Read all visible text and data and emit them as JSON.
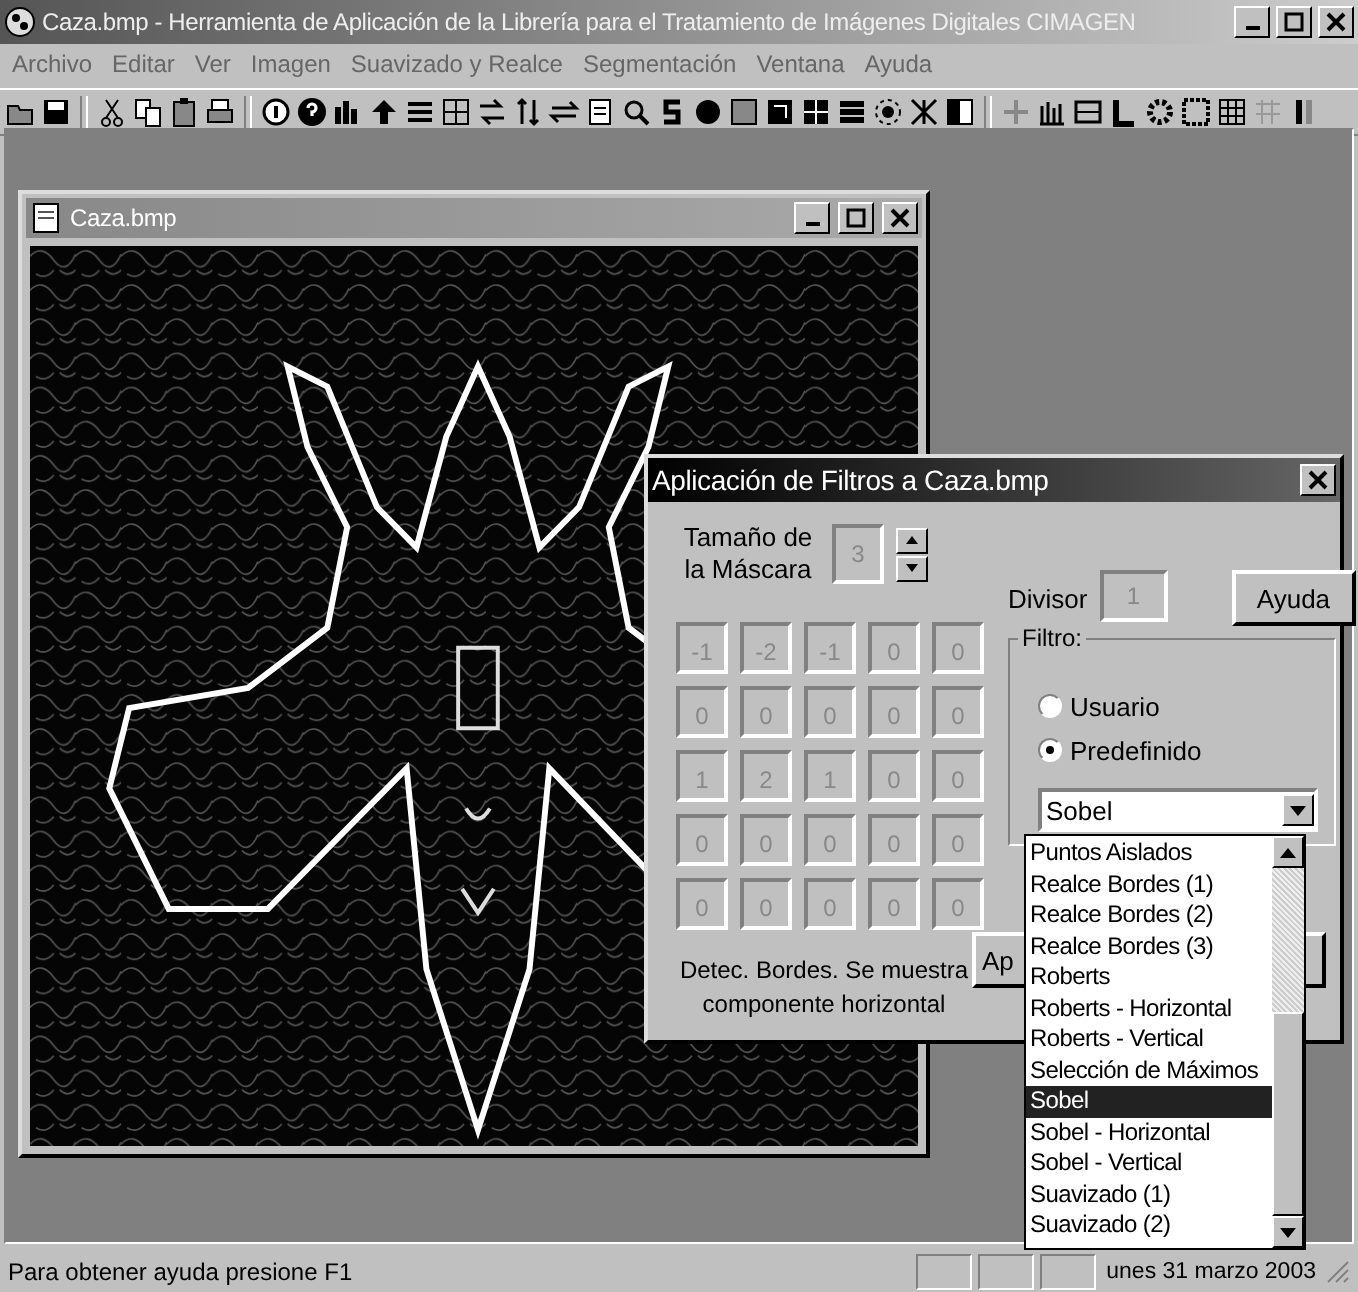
{
  "window": {
    "title": "Caza.bmp - Herramienta de Aplicación de la Librería para el Tratamiento de Imágenes Digitales CIMAGEN"
  },
  "menu": [
    "Archivo",
    "Editar",
    "Ver",
    "Imagen",
    "Suavizado y Realce",
    "Segmentación",
    "Ventana",
    "Ayuda"
  ],
  "child_window": {
    "title": "Caza.bmp"
  },
  "dialog": {
    "title": "Aplicación de Filtros a Caza.bmp",
    "mask_size_label": "Tamaño de la Máscara",
    "mask_size": "3",
    "divisor_label": "Divisor",
    "divisor": "1",
    "help_button": "Ayuda",
    "matrix": [
      [
        "-1",
        "-2",
        "-1",
        "0",
        "0"
      ],
      [
        "0",
        "0",
        "0",
        "0",
        "0"
      ],
      [
        "1",
        "2",
        "1",
        "0",
        "0"
      ],
      [
        "0",
        "0",
        "0",
        "0",
        "0"
      ],
      [
        "0",
        "0",
        "0",
        "0",
        "0"
      ]
    ],
    "description": "Detec. Bordes. Se muestra componente horizontal",
    "filter_group": "Filtro:",
    "radios": [
      {
        "label": "Usuario",
        "selected": false
      },
      {
        "label": "Predefinido",
        "selected": true
      }
    ],
    "combo_value": "Sobel",
    "list": [
      {
        "label": "Puntos Aislados",
        "selected": false
      },
      {
        "label": "Realce Bordes (1)",
        "selected": false
      },
      {
        "label": "Realce Bordes (2)",
        "selected": false
      },
      {
        "label": "Realce Bordes (3)",
        "selected": false
      },
      {
        "label": "Roberts",
        "selected": false
      },
      {
        "label": "Roberts - Horizontal",
        "selected": false
      },
      {
        "label": "Roberts - Vertical",
        "selected": false
      },
      {
        "label": "Selección de Máximos",
        "selected": false
      },
      {
        "label": "Sobel",
        "selected": true
      },
      {
        "label": "Sobel - Horizontal",
        "selected": false
      },
      {
        "label": "Sobel - Vertical",
        "selected": false
      },
      {
        "label": "Suavizado (1)",
        "selected": false
      },
      {
        "label": "Suavizado (2)",
        "selected": false
      }
    ],
    "apply_button": "Ap"
  },
  "status_bar": {
    "message": "Para obtener ayuda presione F1",
    "date": "unes 31 marzo 2003"
  }
}
